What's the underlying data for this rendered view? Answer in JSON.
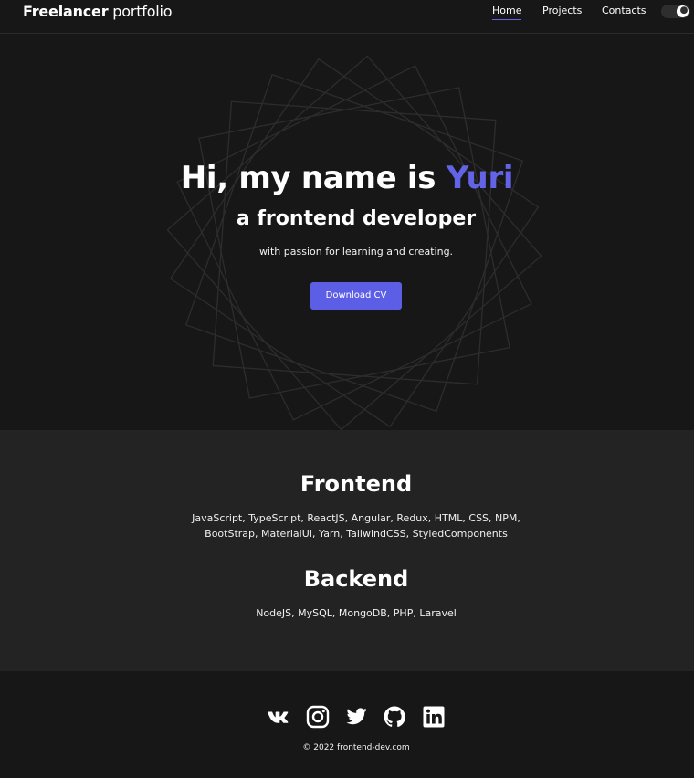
{
  "header": {
    "logo_bold": "Freelancer",
    "logo_light": " portfolio",
    "nav": [
      {
        "label": "Home",
        "active": true
      },
      {
        "label": "Projects",
        "active": false
      },
      {
        "label": "Contacts",
        "active": false
      }
    ],
    "theme_toggle_icon": "moon-icon"
  },
  "hero": {
    "title_prefix": "Hi, my name is ",
    "title_name": "Yuri",
    "subtitle": "a frontend developer",
    "description": "with passion for learning and creating.",
    "cta_label": "Download CV",
    "background_icon": "rotated-squares-decoration"
  },
  "skills": {
    "frontend_title": "Frontend",
    "frontend_line1": "JavaScript, TypeScript, ReactJS, Angular, Redux, HTML, CSS, NPM,",
    "frontend_line2": "BootStrap, MaterialUI, Yarn, TailwindCSS, StyledComponents",
    "backend_title": "Backend",
    "backend_line": "NodeJS, MySQL, MongoDB, PHP, Laravel"
  },
  "footer": {
    "social_icons": [
      "vk-icon",
      "instagram-icon",
      "twitter-icon",
      "github-icon",
      "linkedin-icon"
    ],
    "copyright": "© 2022 frontend-dev.com"
  },
  "colors": {
    "background": "#171717",
    "section_background": "#232323",
    "accent": "#6263e6",
    "text": "#ffffff"
  }
}
